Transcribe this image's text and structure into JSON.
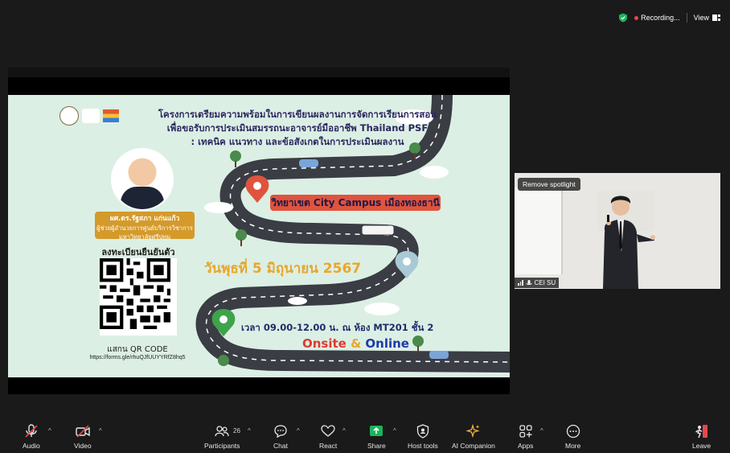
{
  "top_bar": {
    "recording_label": "Recording...",
    "view_label": "View",
    "accent_color": "#1bb45c",
    "record_color": "#e5484d"
  },
  "slide": {
    "title_lines": [
      "โครงการเตรียมความพร้อมในการเขียนผลงานการจัดการเรียนการสอน",
      "เพื่อขอรับการประเมินสมรรถนะอาจารย์มืออาชีพ Thailand PSF",
      ": เทคนิค แนวทาง และข้อสังเกตในการประเมินผลงาน"
    ],
    "speaker_name": "ผศ.ดร.รัฐสภา แก่นแก้ว",
    "speaker_role_line1": "ผู้ช่วยผู้อำนวยการศูนย์บริการวิชาการ",
    "speaker_role_line2": "มหาวิทยาลัยศรีปทุม",
    "register_label": "ลงทะเบียนยืนยันตัวตน",
    "scan_label": "แสกน QR CODE",
    "register_url": "https://forms.gle/rhuQJfUUYYRfZ8hq5",
    "venue": "วิทยาเขต City Campus เมืองทองธานี",
    "date": "วันพุธที่ 5 มิถุนายน 2567",
    "time": "เวลา 09.00-12.00 น.  ณ ห้อง MT201 ชั้น 2",
    "mode_onsite": "Onsite",
    "mode_amp": "&",
    "mode_online": "Online"
  },
  "spotlight": {
    "button_label": "Remove spotlight",
    "participant_name": "CEI SU"
  },
  "toolbar": {
    "audio": "Audio",
    "video": "Video",
    "participants": "Participants",
    "participant_count": "26",
    "chat": "Chat",
    "react": "React",
    "share": "Share",
    "host_tools": "Host tools",
    "ai_companion": "AI Companion",
    "apps": "Apps",
    "more": "More",
    "leave": "Leave",
    "share_color": "#1bb45c",
    "leave_color": "#e5484d",
    "ai_color": "#f0b43c"
  }
}
